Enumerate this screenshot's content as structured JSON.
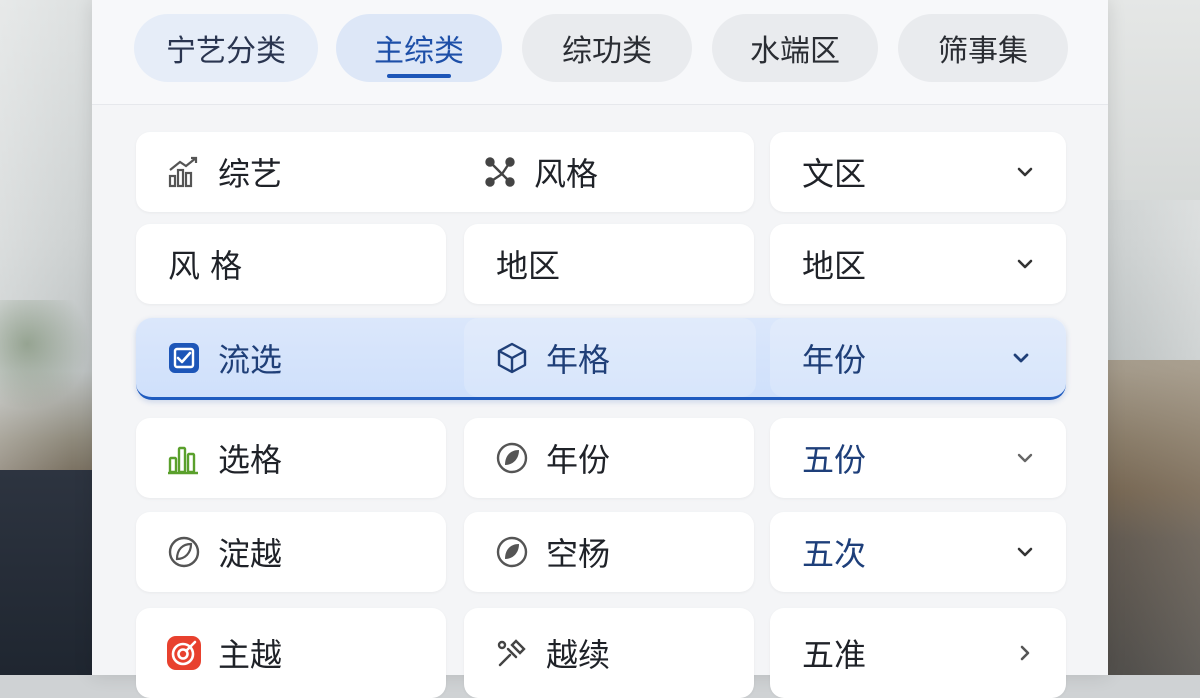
{
  "tabs": [
    {
      "label": "宁艺分类",
      "active": false
    },
    {
      "label": "主综类",
      "active": true
    },
    {
      "label": "综功类",
      "active": false
    },
    {
      "label": "水端区",
      "active": false
    },
    {
      "label": "筛事集",
      "active": false
    }
  ],
  "rows": [
    {
      "c1": "综艺",
      "c1_icon": "bar-chart-up-icon",
      "c2": "风格",
      "c2_icon": "nodes-icon",
      "c3": "文区",
      "chevron": "chevron-down-icon"
    },
    {
      "c1": "风 格",
      "c2": "地区",
      "c3": "地区",
      "chevron": "chevron-down-icon"
    },
    {
      "c1": "流选",
      "c1_icon": "checkbox-icon",
      "c2": "年格",
      "c2_icon": "cube-icon",
      "c3": "年份",
      "chevron": "chevron-down-icon",
      "selected": true
    },
    {
      "c1": "选格",
      "c1_icon": "bar-chart-green-icon",
      "c2": "年份",
      "c2_icon": "leaf-circle-icon",
      "c3": "五份",
      "chevron": "chevron-down-icon"
    },
    {
      "c1": "淀越",
      "c1_icon": "leaf-circle-icon",
      "c2": "空杨",
      "c2_icon": "leaf-circle-icon",
      "c3": "五次",
      "chevron": "chevron-down-icon"
    },
    {
      "c1": "主越",
      "c1_icon": "target-app-icon",
      "c2": "越续",
      "c2_icon": "pin-tool-icon",
      "c3": "五准",
      "chevron": "chevron-right-icon"
    }
  ],
  "colors": {
    "accent": "#1d56b8",
    "selected_bg": "#d6e4fa",
    "text": "#1f2228"
  }
}
